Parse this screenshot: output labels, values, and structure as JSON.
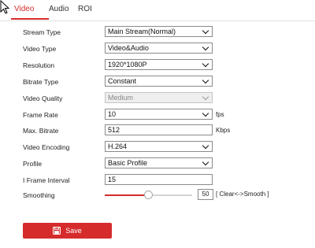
{
  "tabs": [
    {
      "label": "Video",
      "active": true
    },
    {
      "label": "Audio",
      "active": false
    },
    {
      "label": "ROI",
      "active": false
    }
  ],
  "form": {
    "stream_type": {
      "label": "Stream Type",
      "value": "Main Stream(Normal)"
    },
    "video_type": {
      "label": "Video Type",
      "value": "Video&Audio"
    },
    "resolution": {
      "label": "Resolution",
      "value": "1920*1080P"
    },
    "bitrate_type": {
      "label": "Bitrate Type",
      "value": "Constant"
    },
    "video_quality": {
      "label": "Video Quality",
      "value": "Medium",
      "disabled": true
    },
    "frame_rate": {
      "label": "Frame Rate",
      "value": "10",
      "unit": "fps"
    },
    "max_bitrate": {
      "label": "Max. Bitrate",
      "value": "512",
      "unit": "Kbps"
    },
    "video_encoding": {
      "label": "Video Encoding",
      "value": "H.264"
    },
    "profile": {
      "label": "Profile",
      "value": "Basic Profile"
    },
    "i_frame_interval": {
      "label": "I Frame Interval",
      "value": "15"
    },
    "smoothing": {
      "label": "Smoothing",
      "value": "50",
      "hint": "[ Clear<->Smooth ]",
      "level": 0.5
    }
  },
  "save_button": {
    "label": "Save",
    "icon": "save-icon"
  },
  "colors": {
    "accent": "#d52b2b"
  }
}
